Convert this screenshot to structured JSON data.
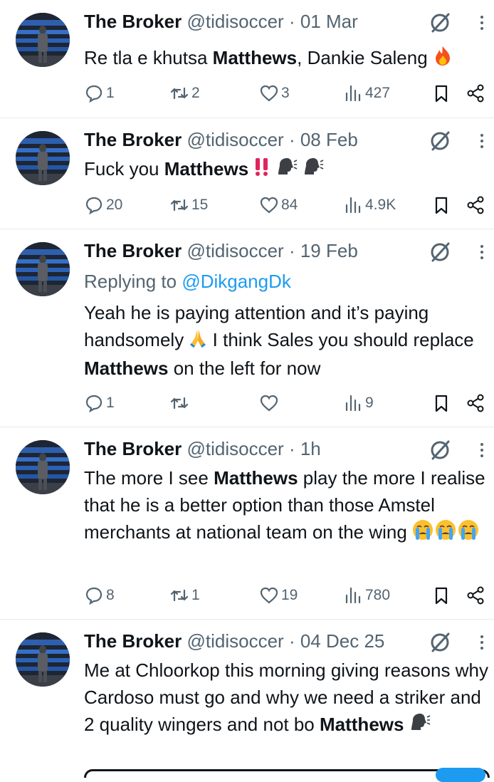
{
  "tweets": [
    {
      "name": "The Broker",
      "handle": "@tidisoccer",
      "date": "· 01 Mar",
      "reply_prefix": "",
      "reply_handle": "",
      "text_parts": [
        "Re tla e khutsa ",
        "Matthews",
        ", Dankie Saleng",
        "🔥",
        "",
        "",
        ""
      ],
      "stats": {
        "replies": "1",
        "reposts": "2",
        "likes": "3",
        "views": "427"
      }
    },
    {
      "name": "The Broker",
      "handle": "@tidisoccer",
      "date": "· 08 Feb",
      "reply_prefix": "",
      "reply_handle": "",
      "text_parts": [
        "Fuck you ",
        "Matthews",
        " ",
        "‼️🗣️🗣️",
        "",
        "",
        ""
      ],
      "stats": {
        "replies": "20",
        "reposts": "15",
        "likes": "84",
        "views": "4.9K"
      }
    },
    {
      "name": "The Broker",
      "handle": "@tidisoccer",
      "date": "· 19 Feb",
      "reply_prefix": "Replying to ",
      "reply_handle": "@DikgangDk",
      "text_parts": [
        "Yeah he is paying attention and it’s paying handsomely ",
        "🙏",
        " I think Sales you should replace ",
        "Matthews",
        " on the left for now",
        "",
        ""
      ],
      "stats": {
        "replies": "1",
        "reposts": "",
        "likes": "",
        "views": "9"
      }
    },
    {
      "name": "The Broker",
      "handle": "@tidisoccer",
      "date": "· 1h",
      "reply_prefix": "",
      "reply_handle": "",
      "text_parts": [
        "The more I see ",
        "Matthews",
        " play the more I realise that he is a better option than those Amstel merchants at national team on the wing ",
        "😭😭😭",
        "",
        "",
        ""
      ],
      "stats": {
        "replies": "8",
        "reposts": "1",
        "likes": "19",
        "views": "780"
      }
    },
    {
      "name": "The Broker",
      "handle": "@tidisoccer",
      "date": "· 04 Dec 25",
      "reply_prefix": "",
      "reply_handle": "",
      "text_parts": [
        "Me at Chloorkop this morning giving reasons why Cardoso must go and why we need a striker and 2  quality wingers and not bo ",
        "Matthews",
        " ",
        "🗣️",
        "",
        "",
        ""
      ],
      "stats": {
        "replies": "",
        "reposts": "",
        "likes": "",
        "views": ""
      }
    }
  ],
  "colors": {
    "text": "#0f1419",
    "muted": "#536471",
    "link": "#1d9bf0",
    "fire": "#f4511e",
    "alert": "#e0245e"
  },
  "icons": [
    "reply-icon",
    "repost-icon",
    "like-icon",
    "views-icon",
    "bookmark-icon",
    "share-icon",
    "grok-icon",
    "more-icon",
    "avatar"
  ]
}
